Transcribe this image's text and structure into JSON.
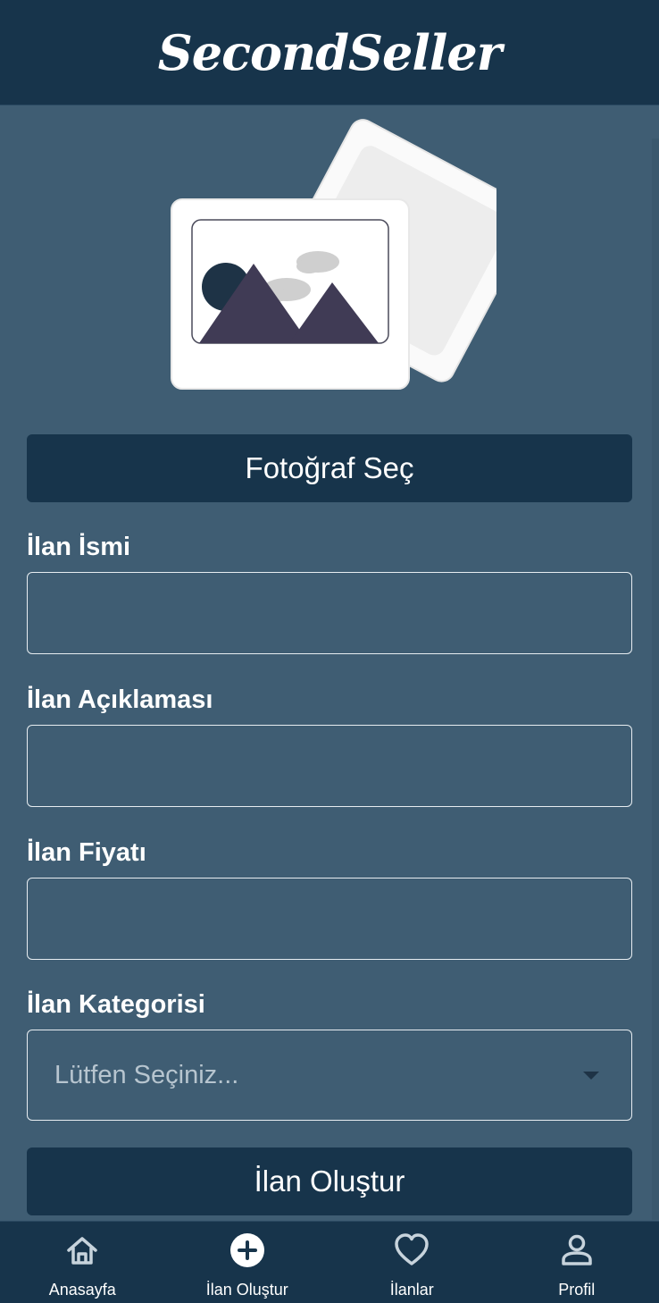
{
  "app": {
    "brand": "SecondSeller"
  },
  "form": {
    "photo_button_label": "Fotoğraf Seç",
    "name_label": "İlan İsmi",
    "name_value": "",
    "description_label": "İlan Açıklaması",
    "description_value": "",
    "price_label": "İlan Fiyatı",
    "price_value": "",
    "category_label": "İlan Kategorisi",
    "category_placeholder": "Lütfen Seçiniz...",
    "submit_label": "İlan Oluştur"
  },
  "nav": {
    "items": [
      {
        "label": "Anasayfa",
        "icon": "home-icon"
      },
      {
        "label": "İlan Oluştur",
        "icon": "plus-circle-icon"
      },
      {
        "label": "İlanlar",
        "icon": "heart-icon"
      },
      {
        "label": "Profil",
        "icon": "user-icon"
      }
    ],
    "active_index": 1
  },
  "colors": {
    "header": "#17344b",
    "background": "#3f5d73",
    "button": "#17344b",
    "text": "#ffffff"
  }
}
